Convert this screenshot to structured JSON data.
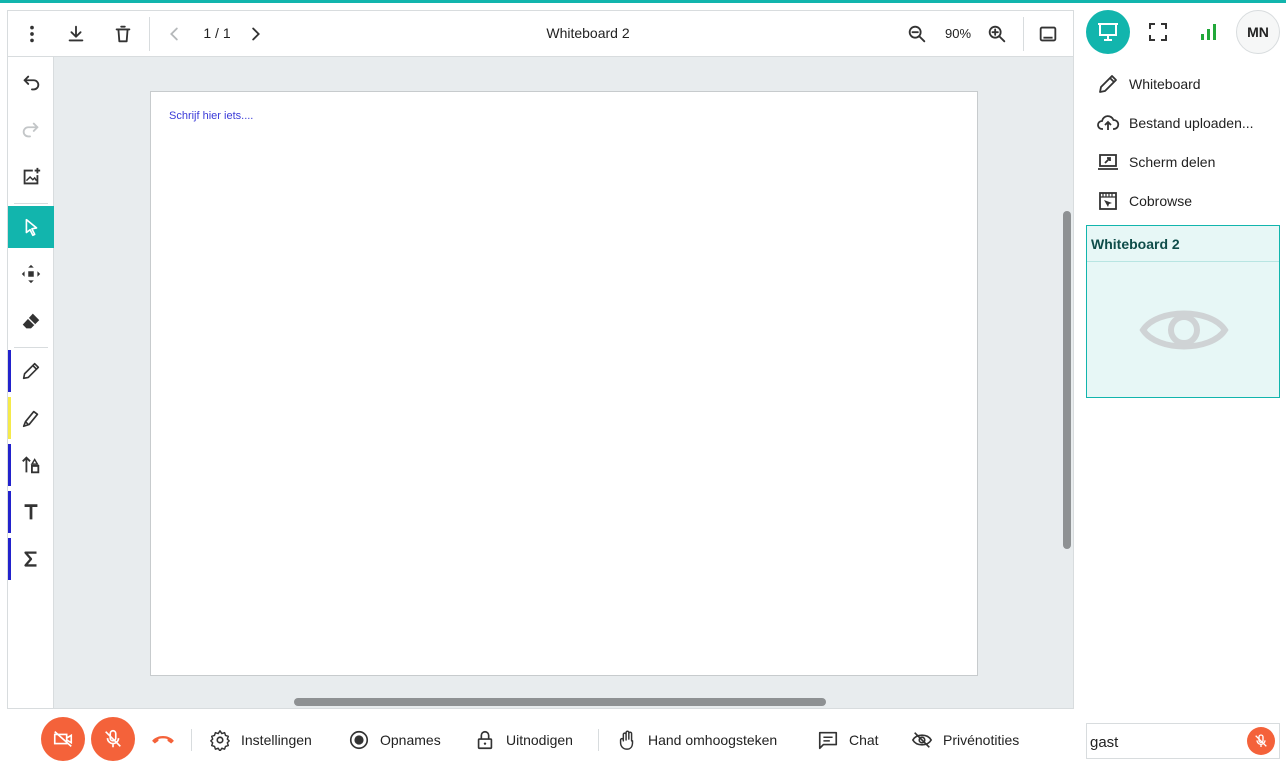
{
  "toolbar": {
    "page_indicator": "1 / 1",
    "title": "Whiteboard 2",
    "zoom": "90%"
  },
  "canvas": {
    "placeholder_text": "Schrijf hier iets...."
  },
  "tool_colors": {
    "active": "#12b5ad",
    "pen": "#2222cc",
    "highlighter": "#f5ea4a",
    "shape": "#2222cc",
    "text": "#2222cc",
    "formula": "#2222cc"
  },
  "right_panel": {
    "avatar_initials": "MN",
    "menu": [
      {
        "icon": "pencil-icon",
        "label": "Whiteboard"
      },
      {
        "icon": "cloud-upload-icon",
        "label": "Bestand uploaden..."
      },
      {
        "icon": "screen-share-icon",
        "label": "Scherm delen"
      },
      {
        "icon": "cobrowse-icon",
        "label": "Cobrowse"
      }
    ],
    "active_card": {
      "title": "Whiteboard 2"
    }
  },
  "bottom_bar": {
    "items": [
      {
        "icon": "gear-icon",
        "label": "Instellingen"
      },
      {
        "icon": "record-icon",
        "label": "Opnames"
      },
      {
        "icon": "lock-icon",
        "label": "Uitnodigen"
      },
      {
        "icon": "hand-icon",
        "label": "Hand omhoogsteken"
      },
      {
        "icon": "chat-icon",
        "label": "Chat"
      },
      {
        "icon": "eye-off-icon",
        "label": "Privénotities"
      }
    ]
  },
  "participant": {
    "name": "gast"
  },
  "colors": {
    "accent": "#12b5ad",
    "danger": "#f4623a",
    "signal": "#22a83a"
  }
}
